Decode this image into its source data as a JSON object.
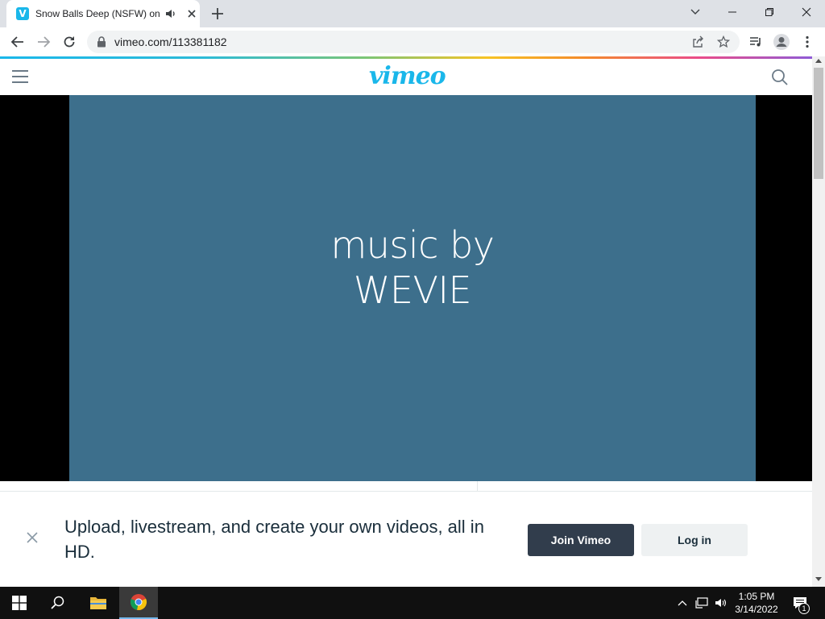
{
  "browser": {
    "tab": {
      "title": "Snow Balls Deep (NSFW) on Vimeo",
      "favicon": "V"
    },
    "url": "vimeo.com/113381182"
  },
  "site": {
    "logo": "vimeo",
    "accent": "#1ab7ea"
  },
  "video": {
    "line1": "music by",
    "line2": "WEVIE",
    "background": "#3d6f8c"
  },
  "banner": {
    "text": "Upload, livestream, and create your own videos, all in HD.",
    "join_label": "Join Vimeo",
    "login_label": "Log in"
  },
  "taskbar": {
    "time": "1:05 PM",
    "date": "3/14/2022",
    "notification_count": "1"
  }
}
